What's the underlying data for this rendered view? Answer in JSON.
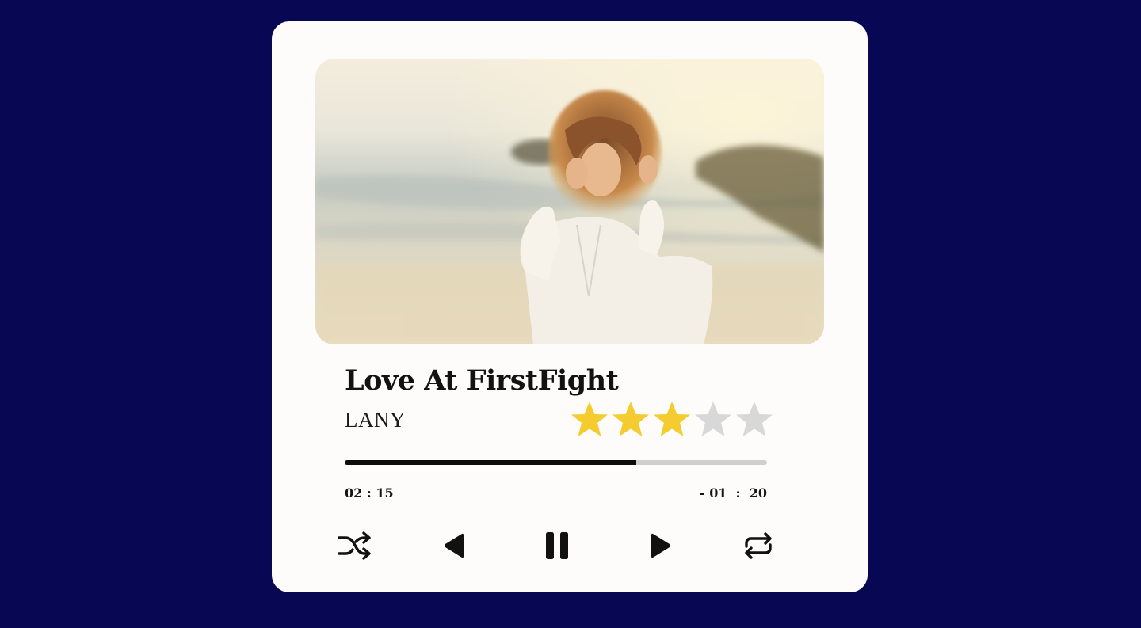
{
  "track": {
    "title": "Love At FirstFight",
    "artist": "LANY",
    "cover_alt": "Woman on a beach at sunset"
  },
  "rating": {
    "value": 3,
    "max": 5
  },
  "playback": {
    "progress_fraction": 0.69,
    "elapsed": "02 : 15",
    "remaining": "- 01  :  20",
    "state": "playing"
  },
  "controls": [
    "shuffle-icon",
    "previous-icon",
    "pause-icon",
    "next-icon",
    "repeat-icon"
  ],
  "colors": {
    "background": "#080754",
    "card": "#fdfcfa",
    "star_filled": "#f5cc2f",
    "star_empty": "#d8d8d8",
    "progress_fill": "#0d0d0d",
    "progress_track": "#cfcfcf"
  }
}
